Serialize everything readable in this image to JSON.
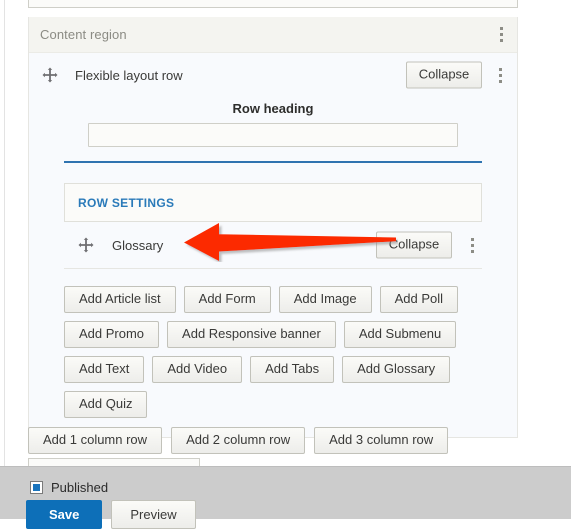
{
  "region": {
    "title": "Content region",
    "menu_icon": "kebab-menu-icon"
  },
  "layout_row": {
    "label": "Flexible layout row",
    "collapse_label": "Collapse",
    "drag_icon": "move-cross-icon",
    "menu_icon": "kebab-menu-icon",
    "heading_label": "Row heading",
    "heading_value": "",
    "heading_placeholder": "",
    "divider_color": "#2f73b0"
  },
  "row_settings": {
    "link_label": "ROW SETTINGS",
    "link_color": "#2a7ab9"
  },
  "component": {
    "label": "Glossary",
    "collapse_label": "Collapse",
    "drag_icon": "move-cross-icon",
    "menu_icon": "kebab-menu-icon"
  },
  "add_buttons": [
    {
      "label": "Add Article list"
    },
    {
      "label": "Add Form"
    },
    {
      "label": "Add Image"
    },
    {
      "label": "Add Poll"
    },
    {
      "label": "Add Promo"
    },
    {
      "label": "Add Responsive banner"
    },
    {
      "label": "Add Submenu"
    },
    {
      "label": "Add Text"
    },
    {
      "label": "Add Video"
    },
    {
      "label": "Add Tabs"
    },
    {
      "label": "Add Glossary"
    },
    {
      "label": "Add Quiz"
    }
  ],
  "column_buttons": [
    {
      "label": "Add 1 column row"
    },
    {
      "label": "Add 2 column row"
    },
    {
      "label": "Add 3 column row"
    }
  ],
  "sticky_bar": {
    "published_label": "Published",
    "published_checked": true,
    "save_label": "Save",
    "preview_label": "Preview",
    "save_color": "#0d6fb8",
    "background": "#cccccc"
  },
  "annotation": {
    "arrow_icon": "red-left-arrow-icon",
    "arrow_color": "#fc2a05",
    "direction": "left"
  }
}
